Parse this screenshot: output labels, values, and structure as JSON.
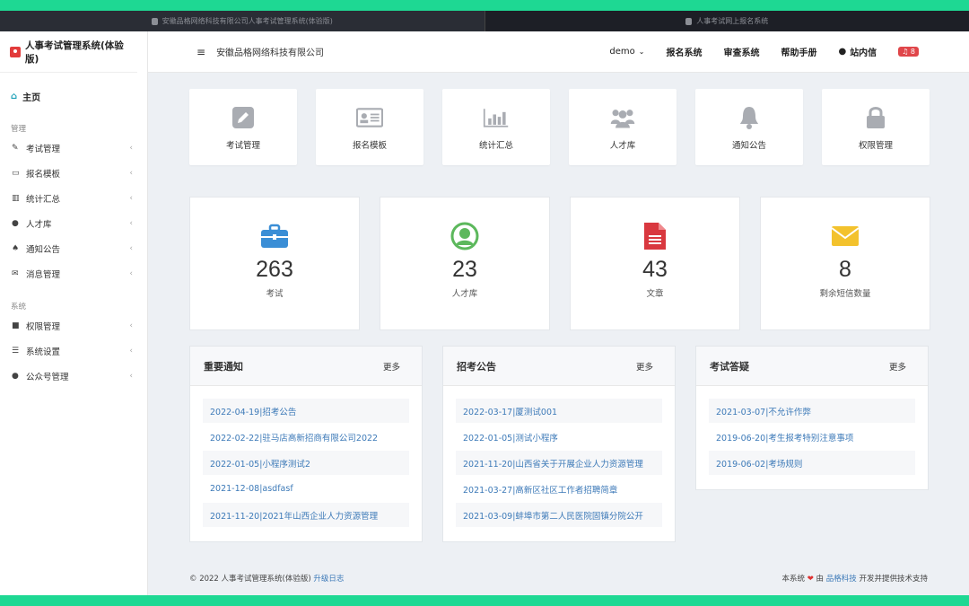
{
  "browser": {
    "tabs": [
      {
        "title": "安徽品格网络科技有限公司人事考试管理系统(体验版)"
      },
      {
        "title": "人事考试网上报名系统"
      }
    ]
  },
  "sidebar": {
    "brand": "人事考试管理系统(体验版)",
    "home": "主页",
    "sections": [
      {
        "title": "管理",
        "items": [
          {
            "label": "考试管理",
            "icon": "edit-icon"
          },
          {
            "label": "报名模板",
            "icon": "id-card-icon"
          },
          {
            "label": "统计汇总",
            "icon": "bar-chart-icon"
          },
          {
            "label": "人才库",
            "icon": "users-icon"
          },
          {
            "label": "通知公告",
            "icon": "bell-icon"
          },
          {
            "label": "消息管理",
            "icon": "envelope-icon"
          }
        ]
      },
      {
        "title": "系统",
        "items": [
          {
            "label": "权限管理",
            "icon": "lock-icon"
          },
          {
            "label": "系统设置",
            "icon": "sliders-icon"
          },
          {
            "label": "公众号管理",
            "icon": "wechat-icon"
          }
        ]
      }
    ]
  },
  "header": {
    "company": "安徽品格网络科技有限公司",
    "user": "demo",
    "nav": [
      "报名系统",
      "审查系统",
      "帮助手册",
      "站内信"
    ],
    "notif_count": "8"
  },
  "quick": [
    {
      "label": "考试管理",
      "icon": "pencil-square-icon"
    },
    {
      "label": "报名模板",
      "icon": "id-card-icon"
    },
    {
      "label": "统计汇总",
      "icon": "bar-chart-icon"
    },
    {
      "label": "人才库",
      "icon": "users-icon"
    },
    {
      "label": "通知公告",
      "icon": "bell-icon"
    },
    {
      "label": "权限管理",
      "icon": "lock-icon"
    }
  ],
  "stats": [
    {
      "value": "263",
      "label": "考试",
      "icon": "briefcase-icon",
      "color": "#3a8ed6"
    },
    {
      "value": "23",
      "label": "人才库",
      "icon": "user-circle-icon",
      "color": "#5cb85c"
    },
    {
      "value": "43",
      "label": "文章",
      "icon": "file-icon",
      "color": "#d9383f"
    },
    {
      "value": "8",
      "label": "剩余短信数量",
      "icon": "envelope-icon",
      "color": "#f3c22d"
    }
  ],
  "panels": [
    {
      "title": "重要通知",
      "more": "更多",
      "items": [
        "2022-04-19|招考公告",
        "2022-02-22|驻马店高新招商有限公司2022",
        "2022-01-05|小程序测试2",
        "2021-12-08|asdfasf",
        "2021-11-20|2021年山西企业人力资源管理"
      ]
    },
    {
      "title": "招考公告",
      "more": "更多",
      "items": [
        "2022-03-17|厦测试001",
        "2022-01-05|测试小程序",
        "2021-11-20|山西省关于开展企业人力资源管理",
        "2021-03-27|高新区社区工作者招聘简章",
        "2021-03-09|蚌埠市第二人民医院固镇分院公开"
      ]
    },
    {
      "title": "考试答疑",
      "more": "更多",
      "items": [
        "2021-03-07|不允许作弊",
        "2019-06-20|考生报考特别注意事项",
        "2019-06-02|考场规则"
      ]
    }
  ],
  "footer": {
    "copyright": "© 2022 ",
    "system": "人事考试管理系统(体验版)",
    "changelog": "升级日志",
    "right_prefix": "本系统",
    "by": "由",
    "company": "品格科技",
    "right_suffix": "开发并提供技术支持"
  }
}
